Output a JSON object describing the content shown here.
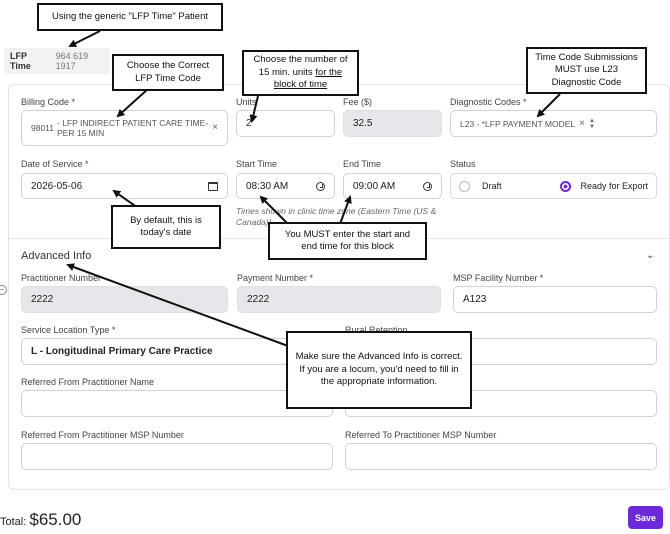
{
  "patient": {
    "name": "LFP Time",
    "number": "964 619 1917"
  },
  "billing": {
    "billing_code_label": "Billing Code *",
    "billing_code": "98011",
    "billing_desc": "- LFP INDIRECT PATIENT CARE TIME- PER 15 MIN",
    "units_label": "Units",
    "units_value": "2",
    "fee_label": "Fee ($)",
    "fee_value": "32.5",
    "diag_label": "Diagnostic Codes *",
    "diag_value": "L23 - *LFP PAYMENT MODEL",
    "dos_label": "Date of Service *",
    "dos_value": "2026-05-06",
    "start_label": "Start Time",
    "start_value": "08:30 AM",
    "end_label": "End Time",
    "end_value": "09:00 AM",
    "tz_note": "Times shown in clinic time zone (Eastern Time (US & Canada))",
    "status_label": "Status",
    "status_draft": "Draft",
    "status_ready": "Ready for Export"
  },
  "advanced": {
    "title": "Advanced Info",
    "practitioner_label": "Practitioner Number",
    "practitioner_value": "2222",
    "payment_label": "Payment Number *",
    "payment_value": "2222",
    "facility_label": "MSP Facility Number *",
    "facility_value": "A123",
    "service_loc_label": "Service Location Type *",
    "service_loc_value": "L - Longitudinal Primary Care Practice",
    "rural_label": "Rural Retention",
    "ref_from_label": "Referred From Practitioner Name",
    "ref_from_msp_label": "Referred From Practitioner MSP Number",
    "ref_to_msp_label": "Referred To Practitioner MSP Number"
  },
  "footer": {
    "total_label": "Total:",
    "total_value": "$65.00",
    "save_label": "Save"
  },
  "annotations": {
    "patient": "Using the generic \"LFP Time\" Patient",
    "code": "Choose the Correct LFP Time Code",
    "units_pre": "Choose the number of 15 min. units ",
    "units_u": "for the block of time",
    "diag": "Time Code Submissions MUST use L23 Diagnostic Code",
    "date": "By default, this is today's date",
    "times": "You MUST enter the start and end time for this block",
    "advanced": "Make sure the Advanced Info is correct.  If you are a locum, you'd need to fill in the appropriate information."
  },
  "colors": {
    "accent": "#6d28d9"
  }
}
